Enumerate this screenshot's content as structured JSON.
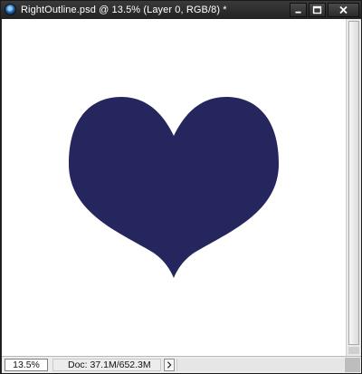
{
  "window": {
    "title": "RightOutline.psd @ 13.5% (Layer 0, RGB/8) *",
    "app_icon": "photoshop-document-icon",
    "controls": [
      "minimize-icon",
      "maximize-icon",
      "close-icon"
    ]
  },
  "canvas": {
    "background": "#ffffff",
    "shape": "heart",
    "shape_fill": "#25265e"
  },
  "statusbar": {
    "zoom_value": "13.5%",
    "doc_info": "Doc: 37.1M/652.3M",
    "menu_arrow": "chevron-right-icon"
  },
  "colors": {
    "titlebar": "#2b2b2b",
    "title_text": "#ffffff",
    "heart": "#25265e"
  }
}
